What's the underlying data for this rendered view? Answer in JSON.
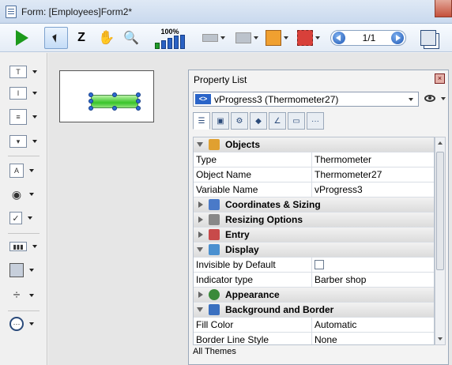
{
  "window": {
    "title": "Form: [Employees]Form2*"
  },
  "toolbar": {
    "zoom_label": "100%",
    "page_indicator": "1/1"
  },
  "palette": {
    "items": [
      {
        "name": "text-tool",
        "glyph": "T"
      },
      {
        "name": "field-tool",
        "glyph": "I"
      },
      {
        "name": "list-tool",
        "glyph": "≡"
      },
      {
        "name": "combo-tool",
        "glyph": "▾"
      },
      {
        "name": "button-tool",
        "glyph": "A"
      },
      {
        "name": "radio-tool",
        "glyph": "◉"
      },
      {
        "name": "checkbox-tool",
        "glyph": "✓"
      },
      {
        "name": "thermometer-tool",
        "glyph": "▮▮▮"
      },
      {
        "name": "rectangle-tool",
        "glyph": "■"
      },
      {
        "name": "splitter-tool",
        "glyph": "÷"
      },
      {
        "name": "plugin-tool",
        "glyph": "⋯"
      }
    ]
  },
  "panel": {
    "title": "Property List",
    "object_selector": {
      "icon": "<>",
      "value": "vProgress3 (Thermometer27)"
    },
    "tabs": [
      "list",
      "db",
      "gear",
      "chart",
      "monitor",
      "more"
    ],
    "rows": [
      {
        "kind": "group",
        "label": "Objects",
        "open": true,
        "color": "#e0a030"
      },
      {
        "kind": "prop",
        "key": "Type",
        "value": "Thermometer"
      },
      {
        "kind": "prop",
        "key": "Object Name",
        "value": "Thermometer27"
      },
      {
        "kind": "prop",
        "key": "Variable Name",
        "value": "vProgress3"
      },
      {
        "kind": "group",
        "label": "Coordinates & Sizing",
        "open": false,
        "color": "#4a7ac8"
      },
      {
        "kind": "group",
        "label": "Resizing Options",
        "open": false,
        "color": "#888888"
      },
      {
        "kind": "group",
        "label": "Entry",
        "open": false,
        "color": "#c84a4a"
      },
      {
        "kind": "group",
        "label": "Display",
        "open": true,
        "color": "#4a90d0"
      },
      {
        "kind": "check",
        "key": "Invisible by Default"
      },
      {
        "kind": "prop",
        "key": "Indicator type",
        "value": "Barber shop"
      },
      {
        "kind": "group",
        "label": "Appearance",
        "open": false,
        "color": "#3a8a3a"
      },
      {
        "kind": "group",
        "label": "Background and Border",
        "open": true,
        "color": "#3a70c0"
      },
      {
        "kind": "prop",
        "key": "Fill Color",
        "value": "Automatic"
      },
      {
        "kind": "prop",
        "key": "Border Line Style",
        "value": "None"
      }
    ],
    "footer": "All Themes"
  }
}
